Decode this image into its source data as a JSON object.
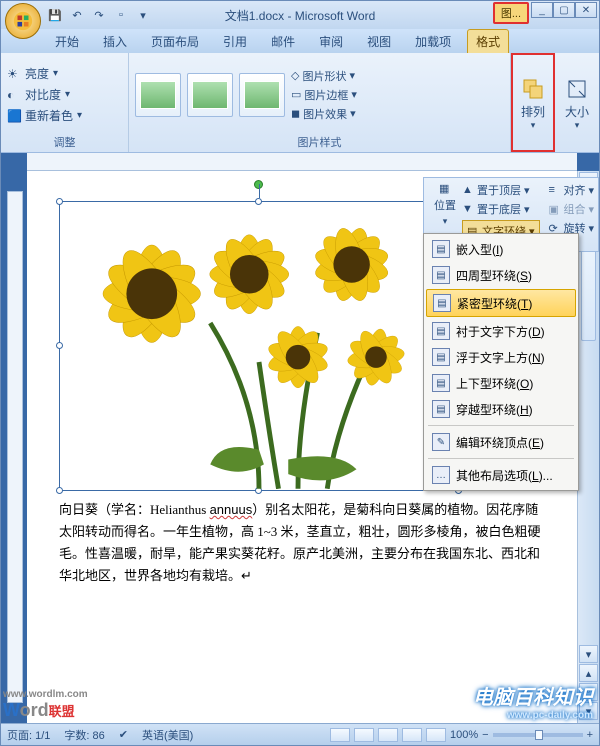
{
  "window": {
    "title": "文档1.docx - Microsoft Word",
    "tool_chip": "图..."
  },
  "tabs": {
    "home": "开始",
    "insert": "插入",
    "layout": "页面布局",
    "references": "引用",
    "mail": "邮件",
    "review": "审阅",
    "view": "视图",
    "addins": "加载项",
    "format": "格式"
  },
  "ribbon": {
    "adjust": {
      "label": "调整",
      "brightness": "亮度",
      "contrast": "对比度",
      "recolor": "重新着色"
    },
    "picstyle": {
      "label": "图片样式",
      "shape": "图片形状",
      "border": "图片边框",
      "effects": "图片效果"
    },
    "arrange": {
      "label": "排列"
    },
    "size": {
      "label": "大小"
    }
  },
  "arrange_panel": {
    "position": "位置",
    "bring_front": "置于顶层",
    "send_back": "置于底层",
    "text_wrap": "文字环绕",
    "align": "对齐",
    "group": "组合",
    "rotate": "旋转"
  },
  "wrap_menu": {
    "inline": "嵌入型(I)",
    "square": "四周型环绕(S)",
    "tight": "紧密型环绕(T)",
    "behind": "衬于文字下方(D)",
    "front": "浮于文字上方(N)",
    "topbottom": "上下型环绕(O)",
    "through": "穿越型环绕(H)",
    "editpoints": "编辑环绕顶点(E)",
    "more": "其他布局选项(L)..."
  },
  "document": {
    "text": "向日葵（学名：Helianthus annuus）别名太阳花，是菊科向日葵属的植物。因花序随太阳转动而得名。一年生植物，高 1~3 米，茎直立，粗壮，圆形多棱角，被白色粗硬毛。性喜温暖，耐旱，能产果实葵花籽。原产北美洲，主要分布在我国东北、西北和华北地区，世界各地均有栽培。",
    "latin": "annuus"
  },
  "status": {
    "page": "页面: 1/1",
    "words": "字数: 86",
    "lang": "英语(美国)",
    "zoom": "100%"
  },
  "watermark": {
    "left_main": "Word",
    "left_sub1": "www.wordlm.com",
    "left_sub2": "联盟",
    "right_main": "电脑百科知识",
    "right_sub": "www.pc-daily.com"
  }
}
